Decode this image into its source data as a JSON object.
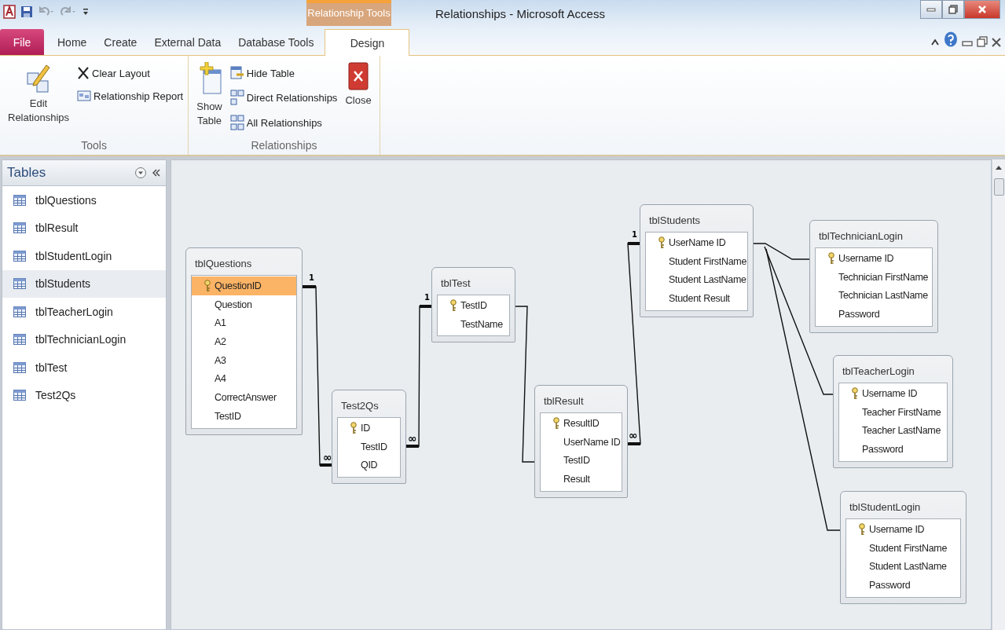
{
  "window": {
    "title": "Relationships - Microsoft Access",
    "context_tab": "Relationship Tools"
  },
  "tabs": [
    {
      "label": "File",
      "kind": "file",
      "selected": false
    },
    {
      "label": "Home",
      "kind": "tab",
      "selected": false
    },
    {
      "label": "Create",
      "kind": "tab",
      "selected": false
    },
    {
      "label": "External Data",
      "kind": "tab",
      "selected": false
    },
    {
      "label": "Database Tools",
      "kind": "tab",
      "selected": false
    },
    {
      "label": "Design",
      "kind": "tab",
      "selected": true
    }
  ],
  "ribbon": {
    "groups": [
      {
        "label": "Tools",
        "large": [
          {
            "label": "Edit Relationships",
            "kind": "edit"
          }
        ],
        "small": [
          {
            "label": "Clear Layout",
            "kind": "clear"
          },
          {
            "label": "Relationship Report",
            "kind": "report"
          }
        ]
      },
      {
        "label": "Relationships",
        "large": [
          {
            "label": "Show Table",
            "kind": "show"
          }
        ],
        "small": [
          {
            "label": "Hide Table",
            "kind": "hide"
          },
          {
            "label": "Direct Relationships",
            "kind": "direct"
          },
          {
            "label": "All Relationships",
            "kind": "all"
          }
        ],
        "after": [
          {
            "label": "Close",
            "kind": "close"
          }
        ]
      }
    ]
  },
  "sidebar": {
    "title": "Tables",
    "items": [
      {
        "label": "tblQuestions",
        "selected": false
      },
      {
        "label": "tblResult",
        "selected": false
      },
      {
        "label": "tblStudentLogin",
        "selected": false
      },
      {
        "label": "tblStudents",
        "selected": true
      },
      {
        "label": "tblTeacherLogin",
        "selected": false
      },
      {
        "label": "tblTechnicianLogin",
        "selected": false
      },
      {
        "label": "tblTest",
        "selected": false
      },
      {
        "label": "Test2Qs",
        "selected": false
      }
    ]
  },
  "diagram": {
    "tables": [
      {
        "name": "tblQuestions",
        "fields": [
          {
            "name": "QuestionID",
            "key": true,
            "selected": true
          },
          {
            "name": "Question",
            "key": false,
            "selected": false
          },
          {
            "name": "A1",
            "key": false,
            "selected": false
          },
          {
            "name": "A2",
            "key": false,
            "selected": false
          },
          {
            "name": "A3",
            "key": false,
            "selected": false
          },
          {
            "name": "A4",
            "key": false,
            "selected": false
          },
          {
            "name": "CorrectAnswer",
            "key": false,
            "selected": false
          },
          {
            "name": "TestID",
            "key": false,
            "selected": false
          }
        ]
      },
      {
        "name": "Test2Qs",
        "fields": [
          {
            "name": "ID",
            "key": true,
            "selected": false
          },
          {
            "name": "TestID",
            "key": false,
            "selected": false
          },
          {
            "name": "QID",
            "key": false,
            "selected": false
          }
        ]
      },
      {
        "name": "tblTest",
        "fields": [
          {
            "name": "TestID",
            "key": true,
            "selected": false
          },
          {
            "name": "TestName",
            "key": false,
            "selected": false
          }
        ]
      },
      {
        "name": "tblResult",
        "fields": [
          {
            "name": "ResultID",
            "key": true,
            "selected": false
          },
          {
            "name": "UserName ID",
            "key": false,
            "selected": false
          },
          {
            "name": "TestID",
            "key": false,
            "selected": false
          },
          {
            "name": "Result",
            "key": false,
            "selected": false
          }
        ]
      },
      {
        "name": "tblStudents",
        "fields": [
          {
            "name": "UserName ID",
            "key": true,
            "selected": false
          },
          {
            "name": "Student FirstName",
            "key": false,
            "selected": false
          },
          {
            "name": "Student LastName",
            "key": false,
            "selected": false
          },
          {
            "name": "Student Result",
            "key": false,
            "selected": false
          }
        ]
      },
      {
        "name": "tblTechnicianLogin",
        "fields": [
          {
            "name": "Username ID",
            "key": true,
            "selected": false
          },
          {
            "name": "Technician FirstName",
            "key": false,
            "selected": false
          },
          {
            "name": "Technician LastName",
            "key": false,
            "selected": false
          },
          {
            "name": "Password",
            "key": false,
            "selected": false
          }
        ]
      },
      {
        "name": "tblTeacherLogin",
        "fields": [
          {
            "name": "Username ID",
            "key": true,
            "selected": false
          },
          {
            "name": "Teacher FirstName",
            "key": false,
            "selected": false
          },
          {
            "name": "Teacher LastName",
            "key": false,
            "selected": false
          },
          {
            "name": "Password",
            "key": false,
            "selected": false
          }
        ]
      },
      {
        "name": "tblStudentLogin",
        "fields": [
          {
            "name": "Username ID",
            "key": true,
            "selected": false
          },
          {
            "name": "Student FirstName",
            "key": false,
            "selected": false
          },
          {
            "name": "Student LastName",
            "key": false,
            "selected": false
          },
          {
            "name": "Password",
            "key": false,
            "selected": false
          }
        ]
      }
    ],
    "relationships": [
      {
        "enforced": true,
        "one": "1",
        "many": "∞"
      },
      {
        "enforced": true,
        "one": "1",
        "many": "∞"
      },
      {
        "enforced": false
      },
      {
        "enforced": true,
        "one": "1",
        "many": "∞"
      },
      {
        "enforced": false
      },
      {
        "enforced": false
      },
      {
        "enforced": false
      }
    ]
  }
}
